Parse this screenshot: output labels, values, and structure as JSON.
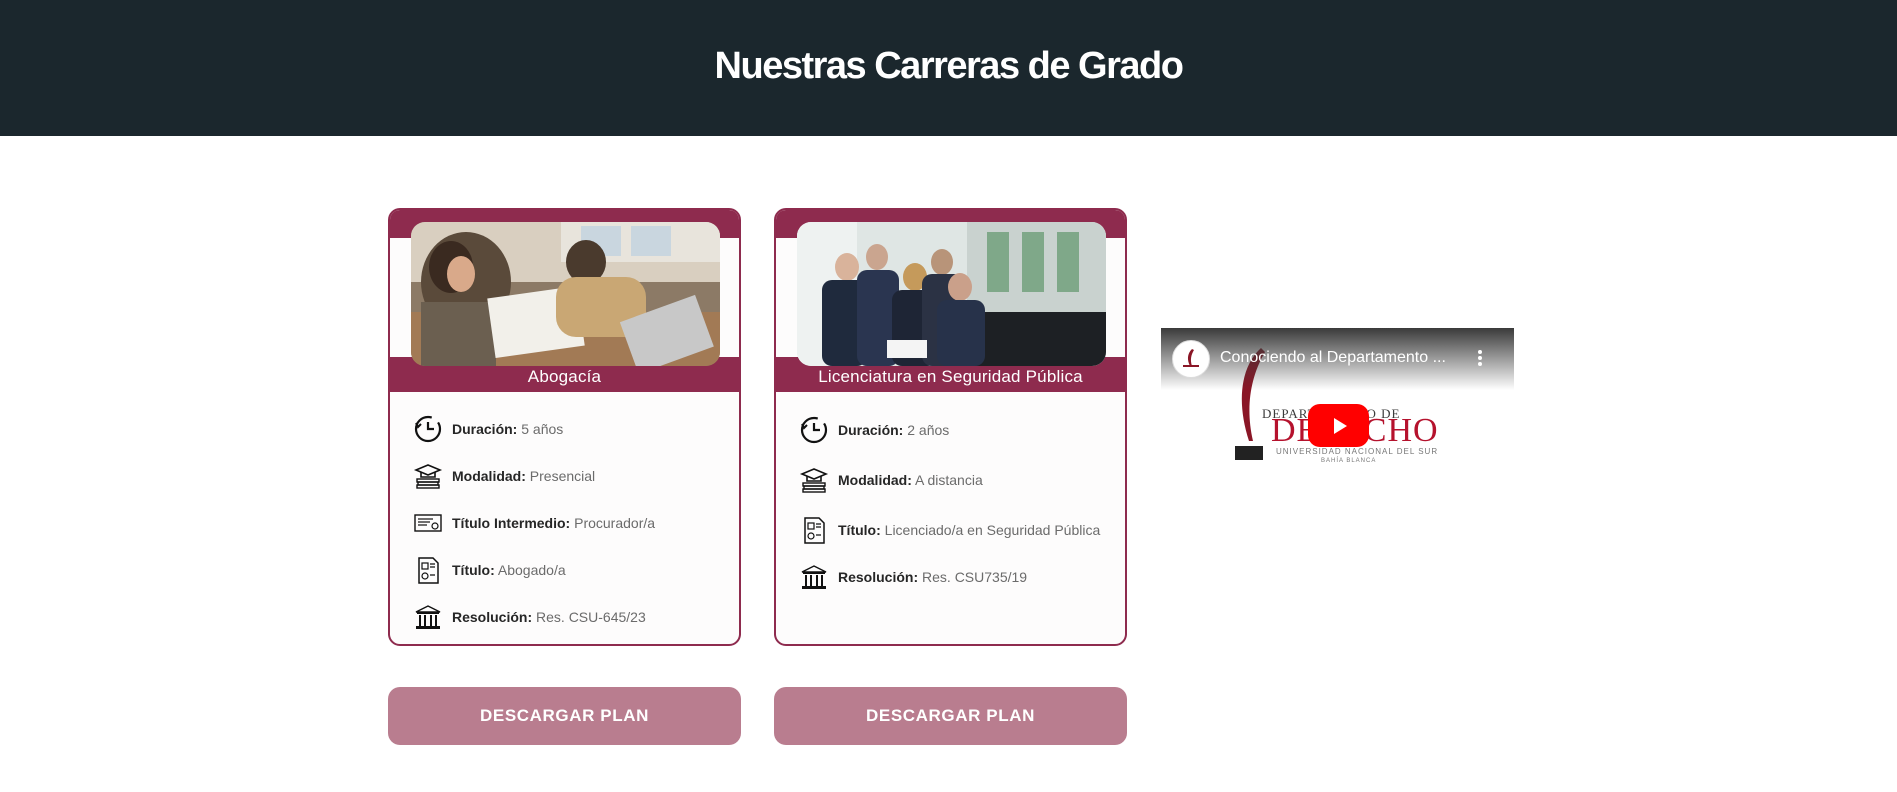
{
  "header": {
    "title": "Nuestras Carreras de Grado"
  },
  "careers": [
    {
      "name": "Abogacía",
      "rows": [
        {
          "icon": "clock-icon",
          "label": "Duración:",
          "value": "5 años"
        },
        {
          "icon": "graduation-cap-icon",
          "label": "Modalidad:",
          "value": "Presencial"
        },
        {
          "icon": "certificate-icon",
          "label": "Título Intermedio:",
          "value": "Procurador/a"
        },
        {
          "icon": "diploma-icon",
          "label": "Título:",
          "value": "Abogado/a"
        },
        {
          "icon": "building-icon",
          "label": "Resolución:",
          "value": "Res. CSU-645/23"
        }
      ],
      "button": "DESCARGAR PLAN"
    },
    {
      "name": "Licenciatura en Seguridad Pública",
      "rows": [
        {
          "icon": "clock-icon",
          "label": "Duración:",
          "value": "2 años"
        },
        {
          "icon": "graduation-cap-icon",
          "label": "Modalidad:",
          "value": "A distancia"
        },
        {
          "icon": "diploma-icon",
          "label": "Título:",
          "value": "Licenciado/a en Seguridad Pública"
        },
        {
          "icon": "building-icon",
          "label": "Resolución:",
          "value": "Res. CSU735/19"
        }
      ],
      "button": "DESCARGAR PLAN"
    }
  ],
  "video": {
    "title": "Conociendo al Departamento ...",
    "logo_top": "DEPARTAMENTO DE",
    "logo_word": "DERECHO",
    "logo_sub": "UNIVERSIDAD NACIONAL DEL SUR",
    "logo_sub2": "BAHÍA BLANCA"
  },
  "colors": {
    "header_bg": "#1b272d",
    "accent": "#8e2b4e",
    "button": "#b97d8f",
    "play": "#ff0000"
  }
}
